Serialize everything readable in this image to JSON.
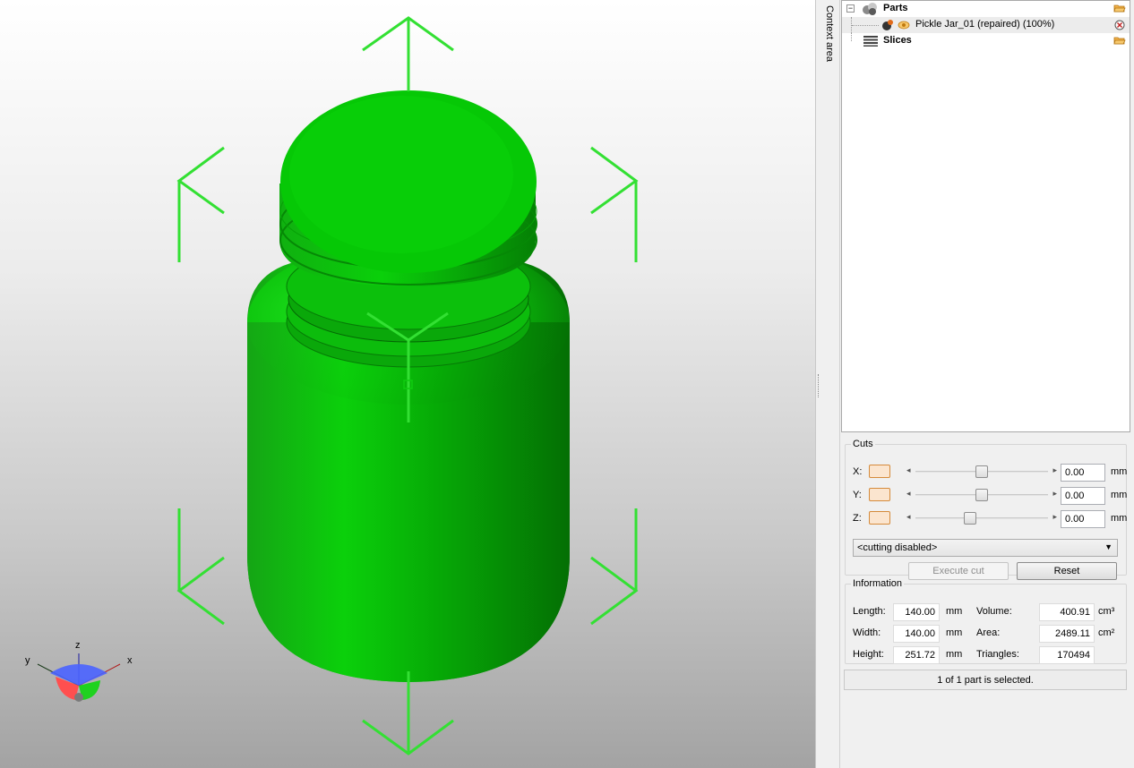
{
  "viewport": {
    "model_color": "#00b400",
    "handle_color": "#33dd33",
    "axes": {
      "x": "x",
      "y": "y",
      "z": "z"
    }
  },
  "context_tab": {
    "label": "Context area"
  },
  "tree": {
    "parts_label": "Parts",
    "part_item_label": "Pickle Jar_01 (repaired) (100%)",
    "slices_label": "Slices",
    "expander_symbol": "−"
  },
  "cuts": {
    "title": "Cuts",
    "rows": [
      {
        "axis": "X:",
        "value": "0.00",
        "unit": "mm",
        "slider_fraction": 0.5
      },
      {
        "axis": "Y:",
        "value": "0.00",
        "unit": "mm",
        "slider_fraction": 0.5
      },
      {
        "axis": "Z:",
        "value": "0.00",
        "unit": "mm",
        "slider_fraction": 0.4
      }
    ],
    "mode_selected": "<cutting disabled>",
    "execute_label": "Execute cut",
    "reset_label": "Reset"
  },
  "information": {
    "title": "Information",
    "length_label": "Length:",
    "length_value": "140.00",
    "length_unit": "mm",
    "width_label": "Width:",
    "width_value": "140.00",
    "width_unit": "mm",
    "height_label": "Height:",
    "height_value": "251.72",
    "height_unit": "mm",
    "volume_label": "Volume:",
    "volume_value": "400.91",
    "volume_unit": "cm³",
    "area_label": "Area:",
    "area_value": "2489.11",
    "area_unit": "cm²",
    "triangles_label": "Triangles:",
    "triangles_value": "170494"
  },
  "status": {
    "selection_text": "1 of 1 part is selected."
  }
}
